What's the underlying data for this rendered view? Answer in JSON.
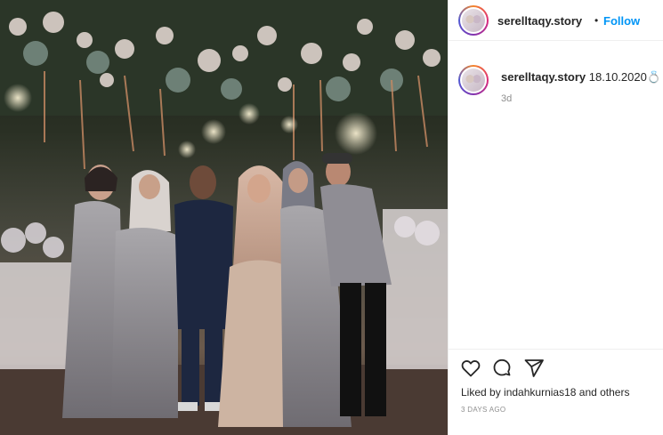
{
  "header": {
    "username": "serelltaqy.story",
    "separator": "•",
    "follow_label": "Follow"
  },
  "caption": {
    "username": "serelltaqy.story",
    "text": "18.10.2020",
    "emoji": "💍",
    "age": "3d"
  },
  "footer": {
    "likes_prefix": "Liked by ",
    "likes_user": "indahkurnias18",
    "likes_suffix": " and others",
    "posted_ago": "3 DAYS AGO"
  },
  "icons": {
    "like": "heart-icon",
    "comment": "comment-icon",
    "share": "share-icon"
  },
  "colors": {
    "link_blue": "#0095f6",
    "text": "#262626",
    "muted": "#8e8e8e"
  }
}
